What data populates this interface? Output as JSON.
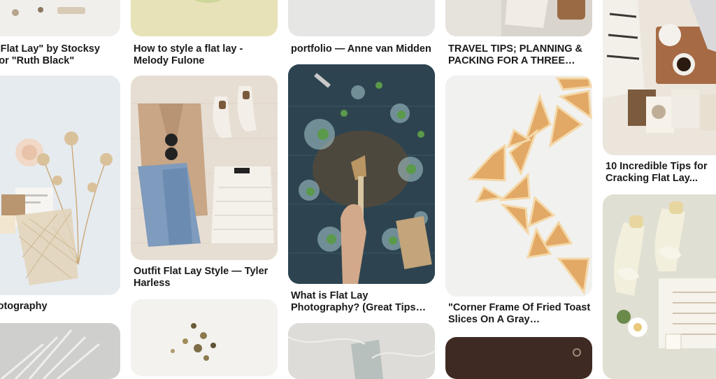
{
  "pins": [
    {
      "title": "umn Flat Lay\" by Stocksy ributor \"Ruth Black\""
    },
    {
      "title": "y Photography"
    },
    {
      "title": "How to style a flat lay - Melody Fulone"
    },
    {
      "title": "Outfit Flat Lay Style — Tyler Harless"
    },
    {
      "title": "portfolio — Anne van Midden"
    },
    {
      "title": "What is Flat Lay Photography? (Great Tips to..."
    },
    {
      "title": "TRAVEL TIPS; PLANNING & PACKING FOR A THREE WE..."
    },
    {
      "title": "\"Corner Frame Of Fried Toast Slices On A Gray Backgroun..."
    },
    {
      "title": "10 Incredible Tips for Cracking Flat Lay..."
    }
  ],
  "colors": {
    "background": "#ffffff",
    "title_text": "#1a1a1a"
  }
}
